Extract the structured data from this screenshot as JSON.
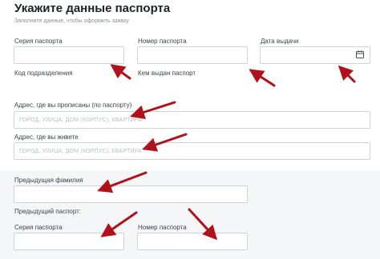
{
  "header": {
    "title": "Укажите данные паспорта",
    "subtitle": "Заполните данные, чтобы оформить заявку"
  },
  "fields": {
    "passport_series": {
      "label": "Серия паспорта",
      "value": ""
    },
    "passport_number": {
      "label": "Номер паспорта",
      "value": ""
    },
    "issue_date": {
      "label": "Дата выдачи",
      "value": ""
    },
    "division_code": {
      "label": "Код подразделения",
      "value": ""
    },
    "issued_by": {
      "label": "Кем выдан паспорт",
      "value": ""
    },
    "registration_address": {
      "label": "Адрес, где вы прописаны (по паспорту)",
      "placeholder": "ГОРОД, УЛИЦА, ДОМ (КОРПУС), КВАРТИРА"
    },
    "living_address": {
      "label": "Адрес, где вы живете",
      "placeholder": "ГОРОД, УЛИЦА, ДОМ (КОРПУС), КВАРТИРА"
    },
    "previous_surname": {
      "label": "Предыдущая фамилия",
      "value": ""
    }
  },
  "previous_passport": {
    "heading": "Предыдущий паспорт:",
    "series": {
      "label": "Серия паспорта",
      "value": ""
    },
    "number": {
      "label": "Номер паспорта",
      "value": ""
    }
  },
  "icons": {
    "date_picker": "calendar-icon",
    "annotation": "red-arrow-icon"
  },
  "colors": {
    "arrow": "#b0121b",
    "border": "#cfd4da",
    "label": "#3d434a",
    "placeholder": "#b9bec4"
  }
}
